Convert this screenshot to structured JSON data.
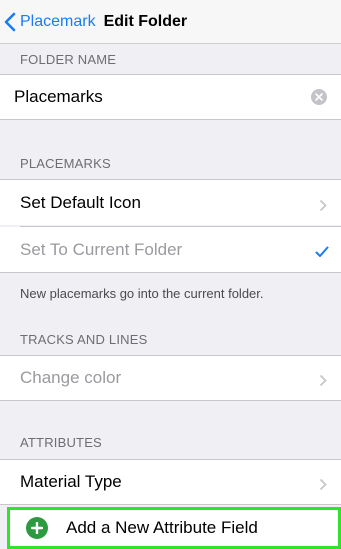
{
  "navbar": {
    "back_label": "Placemark",
    "title": "Edit Folder"
  },
  "folder_name": {
    "header": "FOLDER NAME",
    "value": "Placemarks"
  },
  "placemarks": {
    "header": "PLACEMARKS",
    "set_default_icon": "Set Default Icon",
    "set_to_current_folder": "Set To Current Folder",
    "footer": "New placemarks go into the current folder."
  },
  "tracks": {
    "header": "TRACKS AND LINES",
    "change_color": "Change color"
  },
  "attributes": {
    "header": "ATTRIBUTES",
    "material_type": "Material Type",
    "add_field": "Add a New Attribute Field"
  },
  "colors": {
    "accent": "#1a7cf5",
    "highlight": "#2fe52a",
    "add_icon": "#2e9a3f"
  }
}
